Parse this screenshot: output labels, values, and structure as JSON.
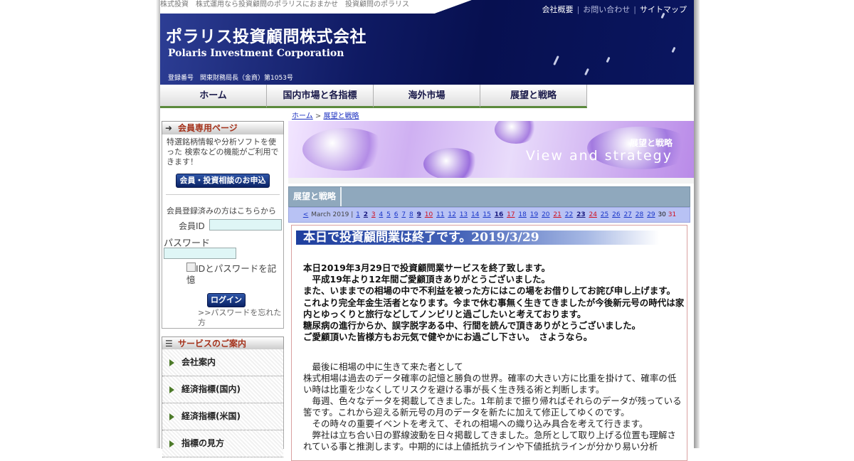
{
  "header": {
    "tagline": "株式投資　株式運用なら投資顧問のポラリスにおまかせ　投資顧問のポラリス",
    "top_links": [
      "会社概要",
      "お問い合わせ",
      "サイトマップ"
    ],
    "logo_jp": "ポラリス投資顧問株式会社",
    "logo_en": "Polaris Investment Corporation",
    "registration": "登録番号　関東財務局長（金商）第1053号"
  },
  "nav": {
    "items": [
      "ホーム",
      "国内市場と各指標",
      "海外市場",
      "展望と戦略"
    ]
  },
  "breadcrumb": {
    "home": "ホーム",
    "sep": ">",
    "current": "展望と戦略"
  },
  "sidebar": {
    "member_title": "会員専用ページ",
    "member_text": "特選銘柄情報や分析ソフトを使った 検索などの機能がご利用できます！",
    "apply_button": "会員・投資相談のお申込",
    "login_intro": "会員登録済みの方はこちらから",
    "id_label": "会員ID",
    "password_label": "パスワード",
    "remember_label": "IDとパスワードを記憶",
    "login_button": "ログイン",
    "forgot": ">>パスワードを忘れた方",
    "service_title": "サービスのご案内",
    "services": [
      "会社案内",
      "経済指標(国内)",
      "経済指標(米国)",
      "指標の見方"
    ]
  },
  "main": {
    "banner_jp": "展望と戦略",
    "banner_en": "View and strategy",
    "tab_label": "展望と戦略",
    "calendar": {
      "prev": "<",
      "month": "March 2019 |",
      "days": [
        "1",
        "2",
        "3",
        "4",
        "5",
        "6",
        "7",
        "8",
        "9",
        "10",
        "11",
        "12",
        "13",
        "14",
        "15",
        "16",
        "17",
        "18",
        "19",
        "20",
        "21",
        "22",
        "23",
        "24",
        "25",
        "26",
        "27",
        "28",
        "29",
        "30",
        "31"
      ]
    },
    "article": {
      "title": "本日で投資顧問業は終了です。2019/3/29",
      "bold_lines": [
        "本日2019年3月29日で投資顧問業サービスを終了致します。",
        "　平成19年より12年間ご愛顧頂きありがとうございました。",
        "また、いままでの相場の中で不利益を被った方にはこの場をお借りしてお詫び申し上げます。",
        "これより完全年金生活者となります。今まで休む事無く生きてきましたが今後新元号の時代は家内とゆっくりと旅行などしてノンビリと過ごしたいと考えております。",
        "糖尿病の進行からか、誤字脱字ある中、行間を読んで頂きありがとうございました。",
        "ご愛顧頂いた皆様方もお元気で健やかにお過ごし下さい。　さようなら。"
      ],
      "normal_lines": [
        "　最後に相場の中に生きて来た者として",
        "株式相場は過去のデータ確率の記憶と勝負の世界。確率の大きい方に比重を掛けて、確率の低い時は比重を少なくしてリスクを避ける事が長く生き残る術と判断します。",
        "　毎週、色々なデータを掲載してきました。1年前まで振り帰ればそれらのデータが残っている筈です。これから迎える新元号の月のデータを新たに加えて修正してゆくのです。",
        "　その時々の重要イベントを考えて、それの相場への織り込み具合を考えて行きます。",
        "　弊社は立ち合い日の罫線波動を日々掲載してきました。急所として取り上げる位置も理解されている事と推測します。中期的には上値抵抗ラインや下値抵抗ラインが分かり易い分析"
      ]
    }
  },
  "colors": {
    "header_bg": "#0a1660",
    "nav_underline": "#5b8a3c",
    "accent_red": "#a4311a",
    "calendar_bg": "#b8c2f4",
    "title_bar": "#1f3f9e"
  }
}
